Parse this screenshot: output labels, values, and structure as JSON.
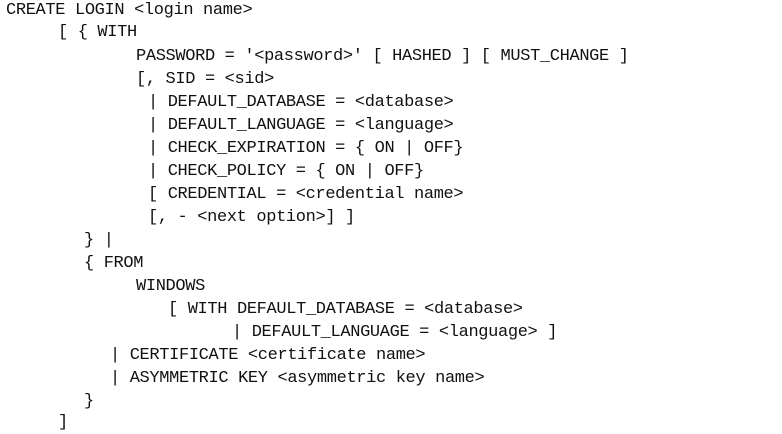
{
  "document": {
    "lines": [
      "CREATE LOGIN <login name>",
      "[ { WITH",
      "PASSWORD = '<password>' [ HASHED ] [ MUST_CHANGE ]",
      "[, SID = <sid>",
      "| DEFAULT_DATABASE = <database>",
      "| DEFAULT_LANGUAGE = <language>",
      "| CHECK_EXPIRATION = { ON | OFF}",
      "| CHECK_POLICY = { ON | OFF}",
      "[ CREDENTIAL = <credential name>",
      "[, - <next option>] ]",
      "} |",
      "{ FROM",
      "WINDOWS",
      "[ WITH DEFAULT_DATABASE = <database>",
      "| DEFAULT_LANGUAGE = <language> ]",
      "| CERTIFICATE <certificate name>",
      "| ASYMMETRIC KEY <asymmetric key name>",
      "}",
      "]"
    ]
  }
}
